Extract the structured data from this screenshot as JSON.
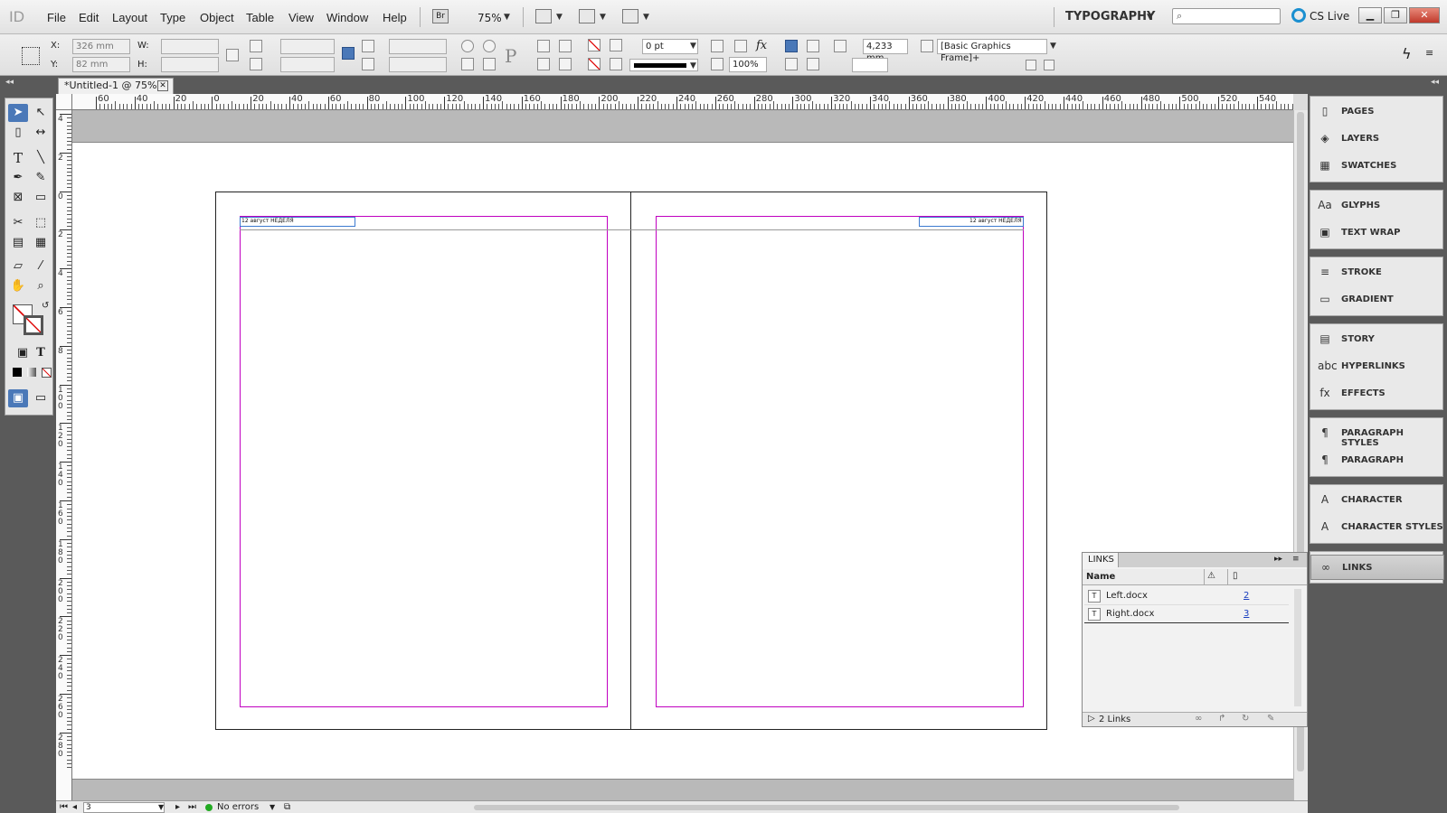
{
  "menubar": {
    "logo": "ID",
    "items": [
      "File",
      "Edit",
      "Layout",
      "Type",
      "Object",
      "Table",
      "View",
      "Window",
      "Help"
    ],
    "bridge_label": "Br",
    "zoom": "75%",
    "workspace": "TYPOGRAPHY",
    "cs_live": "CS Live"
  },
  "control": {
    "x_label": "X:",
    "y_label": "Y:",
    "w_label": "W:",
    "h_label": "H:",
    "x_value": "326 mm",
    "y_value": "82 mm",
    "stroke_weight": "0 pt",
    "opacity": "100%",
    "gap": "4,233 mm",
    "object_style": "[Basic Graphics Frame]+"
  },
  "document": {
    "tab_title": "*Untitled-1 @ 75%",
    "left_header_text": "12 август НЕДЕЛЯ",
    "right_header_text": "12 август НЕДЕЛЯ"
  },
  "ruler": {
    "h_labels": [
      "60",
      "40",
      "20",
      "0",
      "20",
      "40",
      "60",
      "80",
      "100",
      "120",
      "140",
      "160",
      "180",
      "200",
      "220",
      "240",
      "260",
      "280",
      "300",
      "320",
      "340",
      "360",
      "380",
      "400",
      "420",
      "440",
      "460",
      "480",
      "500",
      "520",
      "540"
    ],
    "v_labels": [
      "4",
      "2",
      "0",
      "2",
      "4",
      "6",
      "8",
      "100",
      "120",
      "140",
      "160",
      "180",
      "200",
      "220",
      "240",
      "260",
      "280"
    ]
  },
  "panels": {
    "groups": [
      [
        "PAGES",
        "LAYERS",
        "SWATCHES"
      ],
      [
        "GLYPHS",
        "TEXT WRAP"
      ],
      [
        "STROKE",
        "GRADIENT"
      ],
      [
        "STORY",
        "HYPERLINKS",
        "EFFECTS"
      ],
      [
        "PARAGRAPH STYLES",
        "PARAGRAPH"
      ],
      [
        "CHARACTER",
        "CHARACTER STYLES"
      ],
      [
        "LINKS"
      ]
    ],
    "icons": [
      [
        "▯",
        "◈",
        "▦"
      ],
      [
        "Aa",
        "▣"
      ],
      [
        "≡",
        "▭"
      ],
      [
        "▤",
        "abc",
        "fx"
      ],
      [
        "¶",
        "¶"
      ],
      [
        "A",
        "A"
      ],
      [
        "∞"
      ]
    ]
  },
  "links_panel": {
    "title": "LINKS",
    "col_name": "Name",
    "rows": [
      {
        "name": "Left.docx",
        "page": "2"
      },
      {
        "name": "Right.docx",
        "page": "3"
      }
    ],
    "footer": "2 Links"
  },
  "status": {
    "page": "3",
    "errors": "No errors"
  }
}
